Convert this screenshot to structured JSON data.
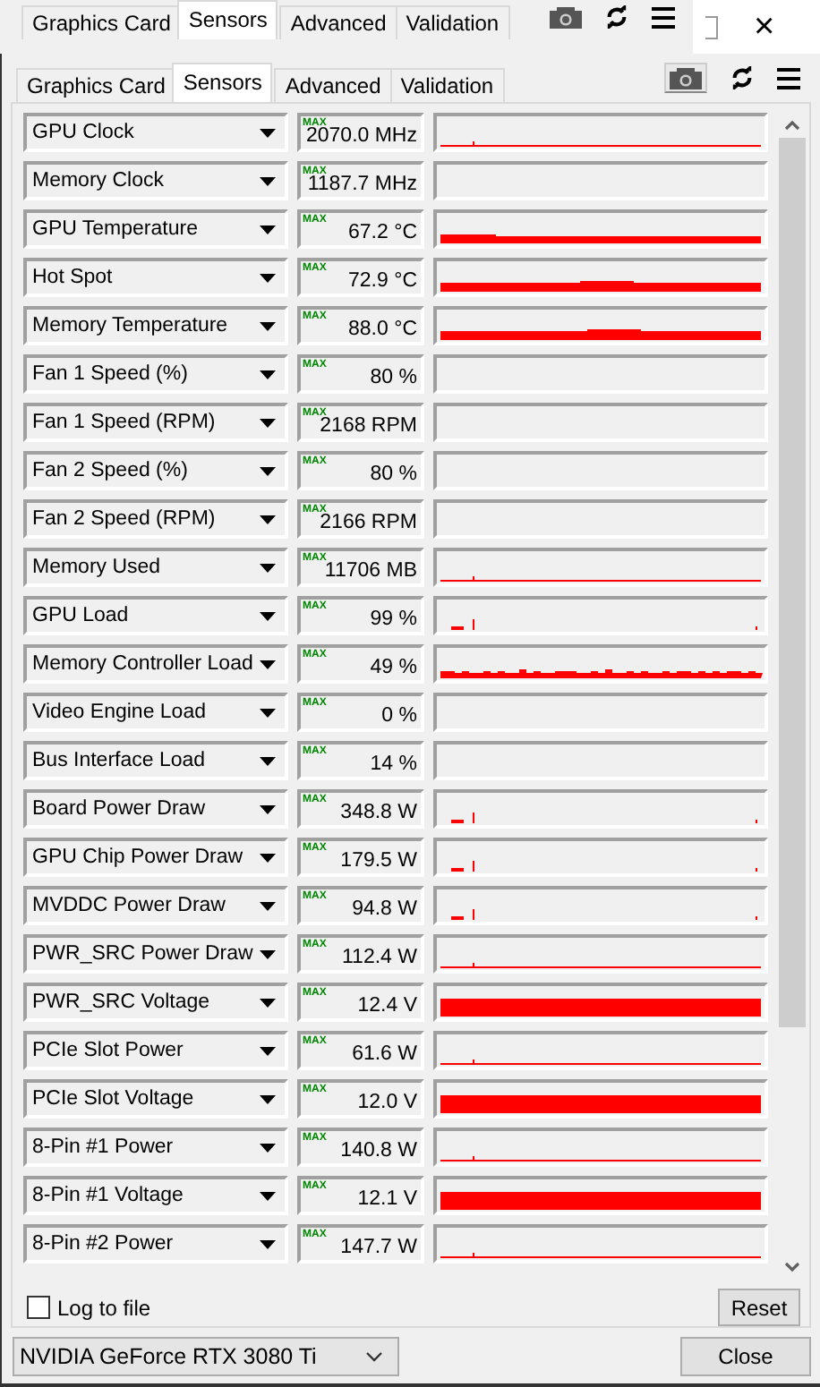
{
  "background_window": {
    "tabs": [
      {
        "label": "Graphics Card",
        "selected": false
      },
      {
        "label": "Sensors",
        "selected": true
      },
      {
        "label": "Advanced",
        "selected": false
      },
      {
        "label": "Validation",
        "selected": false
      }
    ],
    "close": "×"
  },
  "window": {
    "tabs": [
      {
        "label": "Graphics Card",
        "selected": false
      },
      {
        "label": "Sensors",
        "selected": true
      },
      {
        "label": "Advanced",
        "selected": false
      },
      {
        "label": "Validation",
        "selected": false
      }
    ]
  },
  "sensors": [
    {
      "name": "GPU Clock",
      "badge": "MAX",
      "value": "2070.0 MHz",
      "kind": "line"
    },
    {
      "name": "Memory Clock",
      "badge": "MAX",
      "value": "1187.7 MHz",
      "kind": "none"
    },
    {
      "name": "GPU Temperature",
      "badge": "MAX",
      "value": "67.2 °C",
      "kind": "step"
    },
    {
      "name": "Hot Spot",
      "badge": "MAX",
      "value": "72.9 °C",
      "kind": "fill"
    },
    {
      "name": "Memory Temperature",
      "badge": "MAX",
      "value": "88.0 °C",
      "kind": "fill"
    },
    {
      "name": "Fan 1 Speed (%)",
      "badge": "MAX",
      "value": "80 %",
      "kind": "none"
    },
    {
      "name": "Fan 1 Speed (RPM)",
      "badge": "MAX",
      "value": "2168 RPM",
      "kind": "none"
    },
    {
      "name": "Fan 2 Speed (%)",
      "badge": "MAX",
      "value": "80 %",
      "kind": "none"
    },
    {
      "name": "Fan 2 Speed (RPM)",
      "badge": "MAX",
      "value": "2166 RPM",
      "kind": "none"
    },
    {
      "name": "Memory Used",
      "badge": "MAX",
      "value": "11706 MB",
      "kind": "line"
    },
    {
      "name": "GPU Load",
      "badge": "MAX",
      "value": "99 %",
      "kind": "spikes"
    },
    {
      "name": "Memory Controller Load",
      "badge": "MAX",
      "value": "49 %",
      "kind": "noisy"
    },
    {
      "name": "Video Engine Load",
      "badge": "MAX",
      "value": "0 %",
      "kind": "none"
    },
    {
      "name": "Bus Interface Load",
      "badge": "MAX",
      "value": "14 %",
      "kind": "none"
    },
    {
      "name": "Board Power Draw",
      "badge": "MAX",
      "value": "348.8 W",
      "kind": "spikes"
    },
    {
      "name": "GPU Chip Power Draw",
      "badge": "MAX",
      "value": "179.5 W",
      "kind": "spikes"
    },
    {
      "name": "MVDDC Power Draw",
      "badge": "MAX",
      "value": "94.8 W",
      "kind": "spikes"
    },
    {
      "name": "PWR_SRC Power Draw",
      "badge": "MAX",
      "value": "112.4 W",
      "kind": "line"
    },
    {
      "name": "PWR_SRC Voltage",
      "badge": "MAX",
      "value": "12.4 V",
      "kind": "tall"
    },
    {
      "name": "PCIe Slot Power",
      "badge": "MAX",
      "value": "61.6 W",
      "kind": "line"
    },
    {
      "name": "PCIe Slot Voltage",
      "badge": "MAX",
      "value": "12.0 V",
      "kind": "tall"
    },
    {
      "name": "8-Pin #1 Power",
      "badge": "MAX",
      "value": "140.8 W",
      "kind": "line"
    },
    {
      "name": "8-Pin #1 Voltage",
      "badge": "MAX",
      "value": "12.1 V",
      "kind": "tall"
    },
    {
      "name": "8-Pin #2 Power",
      "badge": "MAX",
      "value": "147.7 W",
      "kind": "line"
    }
  ],
  "log_to_file": {
    "label": "Log to file",
    "checked": false
  },
  "reset_button": "Reset",
  "gpu_select": "NVIDIA GeForce RTX 3080 Ti",
  "close_button": "Close"
}
